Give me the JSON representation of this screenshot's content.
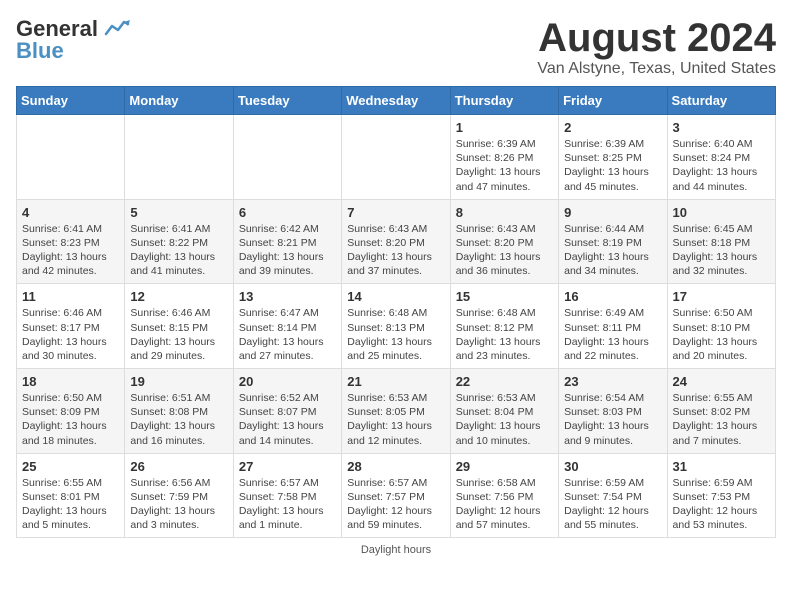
{
  "header": {
    "logo_general": "General",
    "logo_blue": "Blue",
    "month_title": "August 2024",
    "location": "Van Alstyne, Texas, United States"
  },
  "weekdays": [
    "Sunday",
    "Monday",
    "Tuesday",
    "Wednesday",
    "Thursday",
    "Friday",
    "Saturday"
  ],
  "weeks": [
    [
      {
        "day": "",
        "sunrise": "",
        "sunset": "",
        "daylight": ""
      },
      {
        "day": "",
        "sunrise": "",
        "sunset": "",
        "daylight": ""
      },
      {
        "day": "",
        "sunrise": "",
        "sunset": "",
        "daylight": ""
      },
      {
        "day": "",
        "sunrise": "",
        "sunset": "",
        "daylight": ""
      },
      {
        "day": "1",
        "sunrise": "Sunrise: 6:39 AM",
        "sunset": "Sunset: 8:26 PM",
        "daylight": "Daylight: 13 hours and 47 minutes."
      },
      {
        "day": "2",
        "sunrise": "Sunrise: 6:39 AM",
        "sunset": "Sunset: 8:25 PM",
        "daylight": "Daylight: 13 hours and 45 minutes."
      },
      {
        "day": "3",
        "sunrise": "Sunrise: 6:40 AM",
        "sunset": "Sunset: 8:24 PM",
        "daylight": "Daylight: 13 hours and 44 minutes."
      }
    ],
    [
      {
        "day": "4",
        "sunrise": "Sunrise: 6:41 AM",
        "sunset": "Sunset: 8:23 PM",
        "daylight": "Daylight: 13 hours and 42 minutes."
      },
      {
        "day": "5",
        "sunrise": "Sunrise: 6:41 AM",
        "sunset": "Sunset: 8:22 PM",
        "daylight": "Daylight: 13 hours and 41 minutes."
      },
      {
        "day": "6",
        "sunrise": "Sunrise: 6:42 AM",
        "sunset": "Sunset: 8:21 PM",
        "daylight": "Daylight: 13 hours and 39 minutes."
      },
      {
        "day": "7",
        "sunrise": "Sunrise: 6:43 AM",
        "sunset": "Sunset: 8:20 PM",
        "daylight": "Daylight: 13 hours and 37 minutes."
      },
      {
        "day": "8",
        "sunrise": "Sunrise: 6:43 AM",
        "sunset": "Sunset: 8:20 PM",
        "daylight": "Daylight: 13 hours and 36 minutes."
      },
      {
        "day": "9",
        "sunrise": "Sunrise: 6:44 AM",
        "sunset": "Sunset: 8:19 PM",
        "daylight": "Daylight: 13 hours and 34 minutes."
      },
      {
        "day": "10",
        "sunrise": "Sunrise: 6:45 AM",
        "sunset": "Sunset: 8:18 PM",
        "daylight": "Daylight: 13 hours and 32 minutes."
      }
    ],
    [
      {
        "day": "11",
        "sunrise": "Sunrise: 6:46 AM",
        "sunset": "Sunset: 8:17 PM",
        "daylight": "Daylight: 13 hours and 30 minutes."
      },
      {
        "day": "12",
        "sunrise": "Sunrise: 6:46 AM",
        "sunset": "Sunset: 8:15 PM",
        "daylight": "Daylight: 13 hours and 29 minutes."
      },
      {
        "day": "13",
        "sunrise": "Sunrise: 6:47 AM",
        "sunset": "Sunset: 8:14 PM",
        "daylight": "Daylight: 13 hours and 27 minutes."
      },
      {
        "day": "14",
        "sunrise": "Sunrise: 6:48 AM",
        "sunset": "Sunset: 8:13 PM",
        "daylight": "Daylight: 13 hours and 25 minutes."
      },
      {
        "day": "15",
        "sunrise": "Sunrise: 6:48 AM",
        "sunset": "Sunset: 8:12 PM",
        "daylight": "Daylight: 13 hours and 23 minutes."
      },
      {
        "day": "16",
        "sunrise": "Sunrise: 6:49 AM",
        "sunset": "Sunset: 8:11 PM",
        "daylight": "Daylight: 13 hours and 22 minutes."
      },
      {
        "day": "17",
        "sunrise": "Sunrise: 6:50 AM",
        "sunset": "Sunset: 8:10 PM",
        "daylight": "Daylight: 13 hours and 20 minutes."
      }
    ],
    [
      {
        "day": "18",
        "sunrise": "Sunrise: 6:50 AM",
        "sunset": "Sunset: 8:09 PM",
        "daylight": "Daylight: 13 hours and 18 minutes."
      },
      {
        "day": "19",
        "sunrise": "Sunrise: 6:51 AM",
        "sunset": "Sunset: 8:08 PM",
        "daylight": "Daylight: 13 hours and 16 minutes."
      },
      {
        "day": "20",
        "sunrise": "Sunrise: 6:52 AM",
        "sunset": "Sunset: 8:07 PM",
        "daylight": "Daylight: 13 hours and 14 minutes."
      },
      {
        "day": "21",
        "sunrise": "Sunrise: 6:53 AM",
        "sunset": "Sunset: 8:05 PM",
        "daylight": "Daylight: 13 hours and 12 minutes."
      },
      {
        "day": "22",
        "sunrise": "Sunrise: 6:53 AM",
        "sunset": "Sunset: 8:04 PM",
        "daylight": "Daylight: 13 hours and 10 minutes."
      },
      {
        "day": "23",
        "sunrise": "Sunrise: 6:54 AM",
        "sunset": "Sunset: 8:03 PM",
        "daylight": "Daylight: 13 hours and 9 minutes."
      },
      {
        "day": "24",
        "sunrise": "Sunrise: 6:55 AM",
        "sunset": "Sunset: 8:02 PM",
        "daylight": "Daylight: 13 hours and 7 minutes."
      }
    ],
    [
      {
        "day": "25",
        "sunrise": "Sunrise: 6:55 AM",
        "sunset": "Sunset: 8:01 PM",
        "daylight": "Daylight: 13 hours and 5 minutes."
      },
      {
        "day": "26",
        "sunrise": "Sunrise: 6:56 AM",
        "sunset": "Sunset: 7:59 PM",
        "daylight": "Daylight: 13 hours and 3 minutes."
      },
      {
        "day": "27",
        "sunrise": "Sunrise: 6:57 AM",
        "sunset": "Sunset: 7:58 PM",
        "daylight": "Daylight: 13 hours and 1 minute."
      },
      {
        "day": "28",
        "sunrise": "Sunrise: 6:57 AM",
        "sunset": "Sunset: 7:57 PM",
        "daylight": "Daylight: 12 hours and 59 minutes."
      },
      {
        "day": "29",
        "sunrise": "Sunrise: 6:58 AM",
        "sunset": "Sunset: 7:56 PM",
        "daylight": "Daylight: 12 hours and 57 minutes."
      },
      {
        "day": "30",
        "sunrise": "Sunrise: 6:59 AM",
        "sunset": "Sunset: 7:54 PM",
        "daylight": "Daylight: 12 hours and 55 minutes."
      },
      {
        "day": "31",
        "sunrise": "Sunrise: 6:59 AM",
        "sunset": "Sunset: 7:53 PM",
        "daylight": "Daylight: 12 hours and 53 minutes."
      }
    ]
  ],
  "footer": {
    "note": "Daylight hours"
  }
}
